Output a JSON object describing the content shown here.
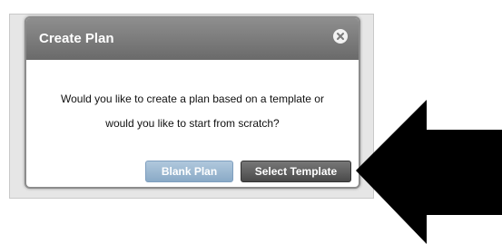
{
  "dialog": {
    "title": "Create Plan",
    "message_line1": "Would you like to create a plan based on a template or",
    "message_line2": "would you like to start from scratch?",
    "close_icon": "close-circle-icon"
  },
  "buttons": {
    "blank_label": "Blank Plan",
    "template_label": "Select Template"
  },
  "annotation": {
    "arrow_icon": "left-pointing-arrow",
    "arrow_color": "#000000"
  },
  "colors": {
    "titlebar": "#7a7a7a",
    "blank_button": "#9bb8d3",
    "template_button": "#5a5a5a"
  }
}
